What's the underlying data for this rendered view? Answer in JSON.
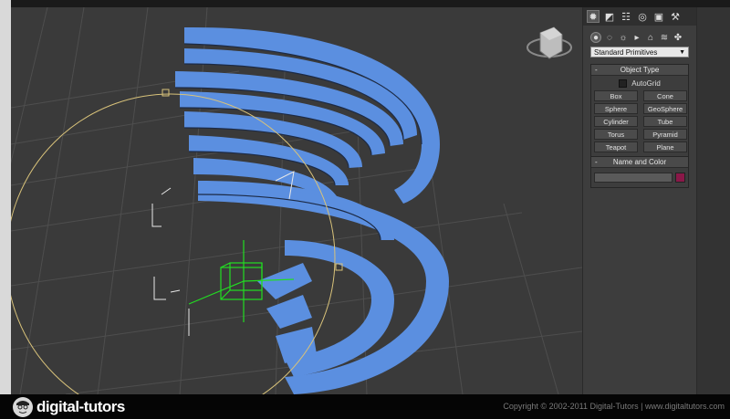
{
  "command_panel": {
    "tabs": [
      {
        "name": "create-tab",
        "glyph": "✹"
      },
      {
        "name": "modify-tab",
        "glyph": "◩"
      },
      {
        "name": "hierarchy-tab",
        "glyph": "☷"
      },
      {
        "name": "motion-tab",
        "glyph": "◎"
      },
      {
        "name": "display-tab",
        "glyph": "▣"
      },
      {
        "name": "utilities-tab",
        "glyph": "⚒"
      }
    ],
    "categories": [
      {
        "name": "geometry-icon",
        "glyph": "●"
      },
      {
        "name": "shapes-icon",
        "glyph": "◌"
      },
      {
        "name": "lights-icon",
        "glyph": "☼"
      },
      {
        "name": "cameras-icon",
        "glyph": "▸"
      },
      {
        "name": "helpers-icon",
        "glyph": "⌂"
      },
      {
        "name": "spacewarps-icon",
        "glyph": "≋"
      },
      {
        "name": "systems-icon",
        "glyph": "✤"
      }
    ],
    "dropdown_value": "Standard Primitives",
    "object_type": {
      "title": "Object Type",
      "autogrid_label": "AutoGrid",
      "buttons": [
        "Box",
        "Cone",
        "Sphere",
        "GeoSphere",
        "Cylinder",
        "Tube",
        "Torus",
        "Pyramid",
        "Teapot",
        "Plane"
      ]
    },
    "name_and_color": {
      "title": "Name and Color",
      "name_value": "",
      "color": "#8a1848"
    },
    "rollout_toggle": "-"
  },
  "footer": {
    "logo_text": "digital-tutors",
    "copyright": "Copyright © 2002-2011 Digital-Tutors  |  www.digitaltutors.com"
  },
  "colors": {
    "object_blue": "#5b8fe0",
    "grid": "#505050",
    "gizmo_green": "#22dd22",
    "orbit_yellow": "#d8c27a"
  }
}
